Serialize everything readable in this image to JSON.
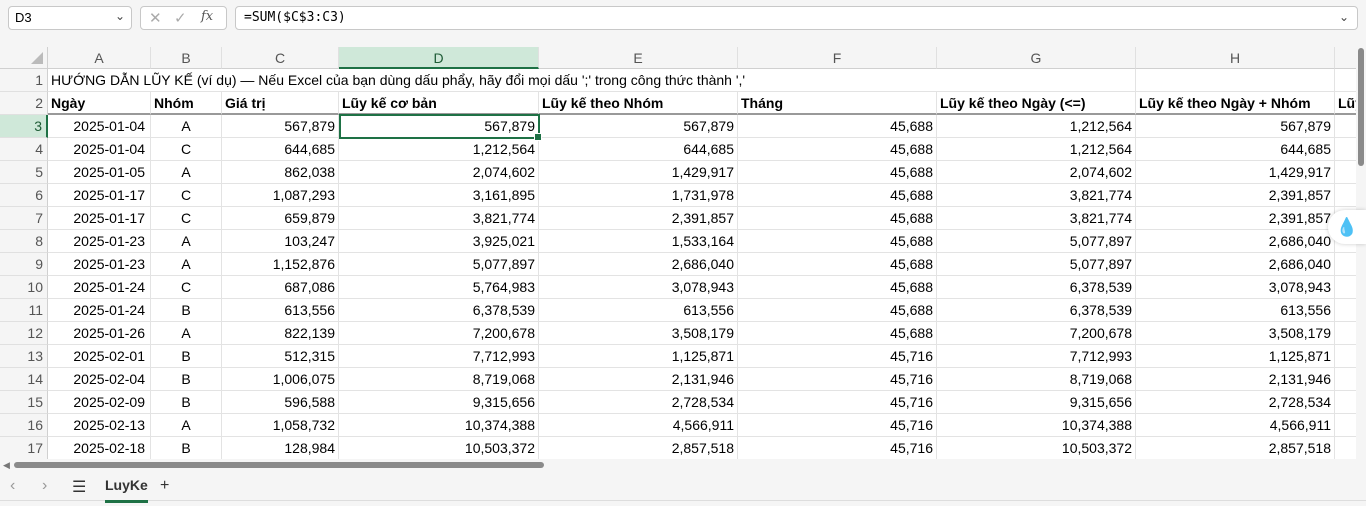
{
  "formula_bar": {
    "name_box": "D3",
    "fx_label": "fx",
    "formula": "=SUM($C$3:C3)"
  },
  "columns": [
    "A",
    "B",
    "C",
    "D",
    "E",
    "F",
    "G",
    "H"
  ],
  "selected_column": "D",
  "selected_row": "3",
  "row1_text": "HƯỚNG DẪN LŨY KẾ (ví dụ) — Nếu Excel của bạn dùng dấu phẩy, hãy đổi mọi dấu ';' trong công thức thành ','",
  "headers": [
    "Ngày",
    "Nhóm",
    "Giá trị",
    "Lũy kế cơ bản",
    "Lũy kế theo Nhóm",
    "Tháng",
    "Lũy kế theo Ngày (<=)",
    "Lũy kế theo Ngày + Nhóm",
    "Lũy"
  ],
  "rows": [
    [
      "3",
      "2025-01-04",
      "A",
      "567,879",
      "567,879",
      "567,879",
      "45,688",
      "1,212,564",
      "567,879"
    ],
    [
      "4",
      "2025-01-04",
      "C",
      "644,685",
      "1,212,564",
      "644,685",
      "45,688",
      "1,212,564",
      "644,685"
    ],
    [
      "5",
      "2025-01-05",
      "A",
      "862,038",
      "2,074,602",
      "1,429,917",
      "45,688",
      "2,074,602",
      "1,429,917"
    ],
    [
      "6",
      "2025-01-17",
      "C",
      "1,087,293",
      "3,161,895",
      "1,731,978",
      "45,688",
      "3,821,774",
      "2,391,857"
    ],
    [
      "7",
      "2025-01-17",
      "C",
      "659,879",
      "3,821,774",
      "2,391,857",
      "45,688",
      "3,821,774",
      "2,391,857"
    ],
    [
      "8",
      "2025-01-23",
      "A",
      "103,247",
      "3,925,021",
      "1,533,164",
      "45,688",
      "5,077,897",
      "2,686,040"
    ],
    [
      "9",
      "2025-01-23",
      "A",
      "1,152,876",
      "5,077,897",
      "2,686,040",
      "45,688",
      "5,077,897",
      "2,686,040"
    ],
    [
      "10",
      "2025-01-24",
      "C",
      "687,086",
      "5,764,983",
      "3,078,943",
      "45,688",
      "6,378,539",
      "3,078,943"
    ],
    [
      "11",
      "2025-01-24",
      "B",
      "613,556",
      "6,378,539",
      "613,556",
      "45,688",
      "6,378,539",
      "613,556"
    ],
    [
      "12",
      "2025-01-26",
      "A",
      "822,139",
      "7,200,678",
      "3,508,179",
      "45,688",
      "7,200,678",
      "3,508,179"
    ],
    [
      "13",
      "2025-02-01",
      "B",
      "512,315",
      "7,712,993",
      "1,125,871",
      "45,716",
      "7,712,993",
      "1,125,871"
    ],
    [
      "14",
      "2025-02-04",
      "B",
      "1,006,075",
      "8,719,068",
      "2,131,946",
      "45,716",
      "8,719,068",
      "2,131,946"
    ],
    [
      "15",
      "2025-02-09",
      "B",
      "596,588",
      "9,315,656",
      "2,728,534",
      "45,716",
      "9,315,656",
      "2,728,534"
    ],
    [
      "16",
      "2025-02-13",
      "A",
      "1,058,732",
      "10,374,388",
      "4,566,911",
      "45,716",
      "10,374,388",
      "4,566,911"
    ],
    [
      "17",
      "2025-02-18",
      "B",
      "128,984",
      "10,503,372",
      "2,857,518",
      "45,716",
      "10,503,372",
      "2,857,518"
    ]
  ],
  "sheet_tabs": [
    "LuyKe"
  ],
  "accent_color": "#1e7145"
}
